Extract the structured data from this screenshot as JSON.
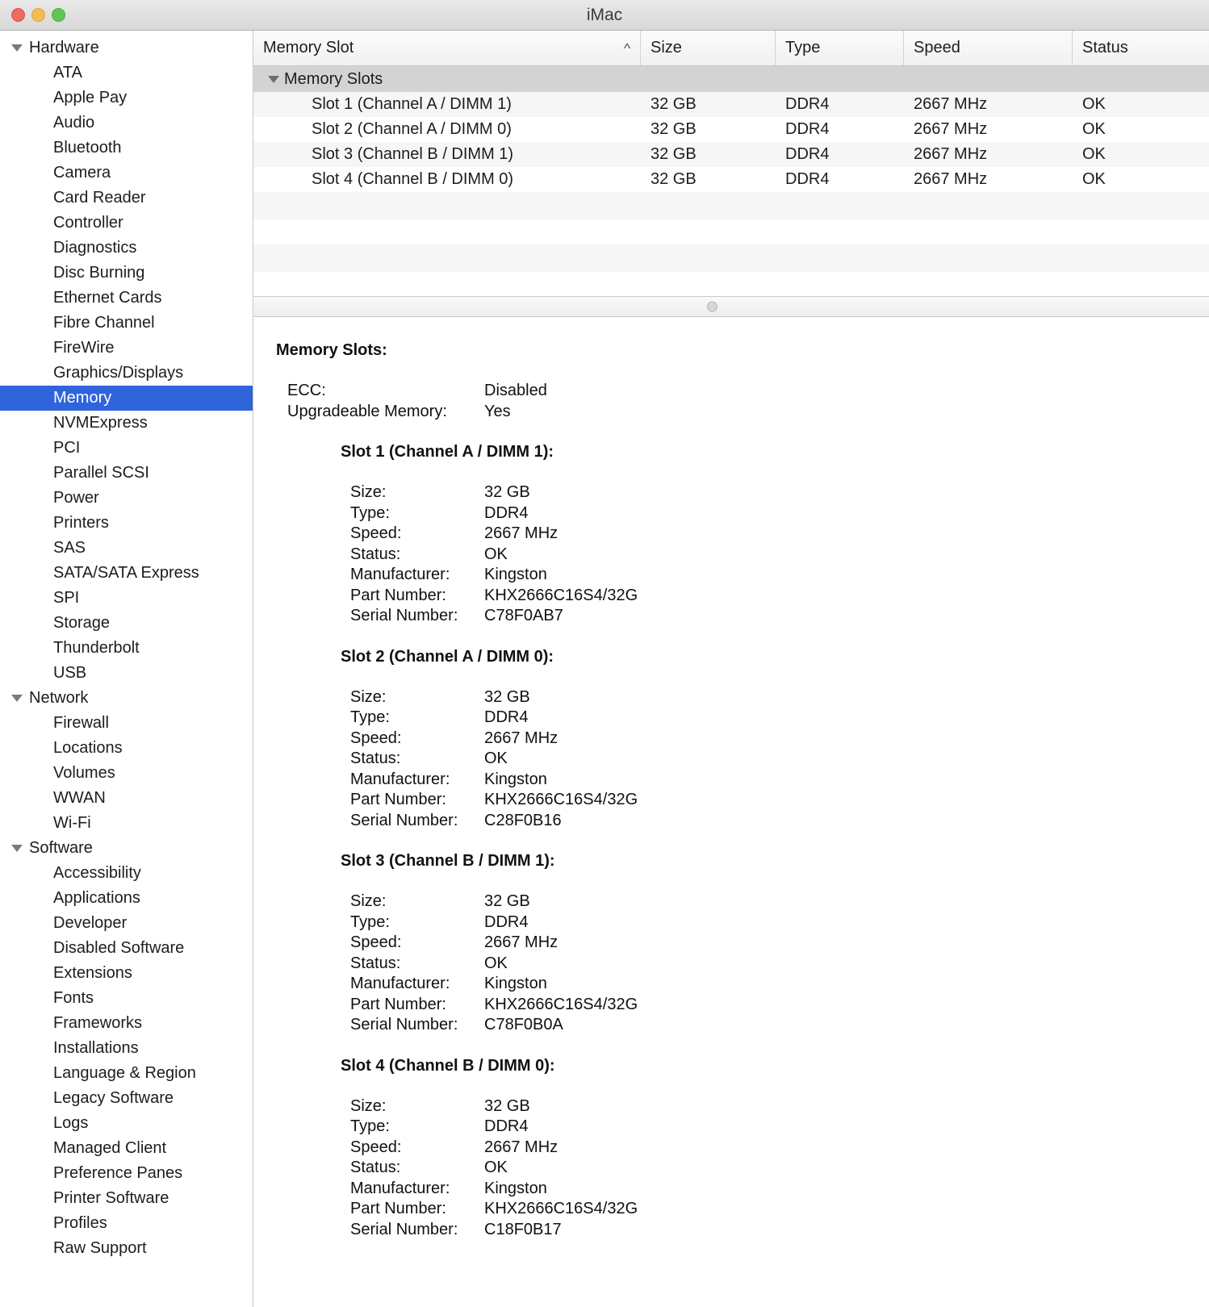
{
  "window": {
    "title": "iMac",
    "traffic_lights": [
      "close",
      "minimize",
      "maximize"
    ]
  },
  "sidebar": {
    "items": [
      {
        "label": "Hardware",
        "type": "group",
        "selected": false
      },
      {
        "label": "ATA",
        "type": "leaf",
        "selected": false
      },
      {
        "label": "Apple Pay",
        "type": "leaf",
        "selected": false
      },
      {
        "label": "Audio",
        "type": "leaf",
        "selected": false
      },
      {
        "label": "Bluetooth",
        "type": "leaf",
        "selected": false
      },
      {
        "label": "Camera",
        "type": "leaf",
        "selected": false
      },
      {
        "label": "Card Reader",
        "type": "leaf",
        "selected": false
      },
      {
        "label": "Controller",
        "type": "leaf",
        "selected": false
      },
      {
        "label": "Diagnostics",
        "type": "leaf",
        "selected": false
      },
      {
        "label": "Disc Burning",
        "type": "leaf",
        "selected": false
      },
      {
        "label": "Ethernet Cards",
        "type": "leaf",
        "selected": false
      },
      {
        "label": "Fibre Channel",
        "type": "leaf",
        "selected": false
      },
      {
        "label": "FireWire",
        "type": "leaf",
        "selected": false
      },
      {
        "label": "Graphics/Displays",
        "type": "leaf",
        "selected": false
      },
      {
        "label": "Memory",
        "type": "leaf",
        "selected": true
      },
      {
        "label": "NVMExpress",
        "type": "leaf",
        "selected": false
      },
      {
        "label": "PCI",
        "type": "leaf",
        "selected": false
      },
      {
        "label": "Parallel SCSI",
        "type": "leaf",
        "selected": false
      },
      {
        "label": "Power",
        "type": "leaf",
        "selected": false
      },
      {
        "label": "Printers",
        "type": "leaf",
        "selected": false
      },
      {
        "label": "SAS",
        "type": "leaf",
        "selected": false
      },
      {
        "label": "SATA/SATA Express",
        "type": "leaf",
        "selected": false
      },
      {
        "label": "SPI",
        "type": "leaf",
        "selected": false
      },
      {
        "label": "Storage",
        "type": "leaf",
        "selected": false
      },
      {
        "label": "Thunderbolt",
        "type": "leaf",
        "selected": false
      },
      {
        "label": "USB",
        "type": "leaf",
        "selected": false
      },
      {
        "label": "Network",
        "type": "group",
        "selected": false
      },
      {
        "label": "Firewall",
        "type": "leaf",
        "selected": false
      },
      {
        "label": "Locations",
        "type": "leaf",
        "selected": false
      },
      {
        "label": "Volumes",
        "type": "leaf",
        "selected": false
      },
      {
        "label": "WWAN",
        "type": "leaf",
        "selected": false
      },
      {
        "label": "Wi-Fi",
        "type": "leaf",
        "selected": false
      },
      {
        "label": "Software",
        "type": "group",
        "selected": false
      },
      {
        "label": "Accessibility",
        "type": "leaf",
        "selected": false
      },
      {
        "label": "Applications",
        "type": "leaf",
        "selected": false
      },
      {
        "label": "Developer",
        "type": "leaf",
        "selected": false
      },
      {
        "label": "Disabled Software",
        "type": "leaf",
        "selected": false
      },
      {
        "label": "Extensions",
        "type": "leaf",
        "selected": false
      },
      {
        "label": "Fonts",
        "type": "leaf",
        "selected": false
      },
      {
        "label": "Frameworks",
        "type": "leaf",
        "selected": false
      },
      {
        "label": "Installations",
        "type": "leaf",
        "selected": false
      },
      {
        "label": "Language & Region",
        "type": "leaf",
        "selected": false
      },
      {
        "label": "Legacy Software",
        "type": "leaf",
        "selected": false
      },
      {
        "label": "Logs",
        "type": "leaf",
        "selected": false
      },
      {
        "label": "Managed Client",
        "type": "leaf",
        "selected": false
      },
      {
        "label": "Preference Panes",
        "type": "leaf",
        "selected": false
      },
      {
        "label": "Printer Software",
        "type": "leaf",
        "selected": false
      },
      {
        "label": "Profiles",
        "type": "leaf",
        "selected": false
      },
      {
        "label": "Raw Support",
        "type": "leaf",
        "selected": false
      }
    ]
  },
  "table": {
    "columns": [
      "Memory Slot",
      "Size",
      "Type",
      "Speed",
      "Status"
    ],
    "sort_indicator": "^",
    "group_label": "Memory Slots",
    "rows": [
      {
        "slot": "Slot 1 (Channel A / DIMM 1)",
        "size": "32 GB",
        "type": "DDR4",
        "speed": "2667 MHz",
        "status": "OK"
      },
      {
        "slot": "Slot 2 (Channel A / DIMM 0)",
        "size": "32 GB",
        "type": "DDR4",
        "speed": "2667 MHz",
        "status": "OK"
      },
      {
        "slot": "Slot 3 (Channel B / DIMM 1)",
        "size": "32 GB",
        "type": "DDR4",
        "speed": "2667 MHz",
        "status": "OK"
      },
      {
        "slot": "Slot 4 (Channel B / DIMM 0)",
        "size": "32 GB",
        "type": "DDR4",
        "speed": "2667 MHz",
        "status": "OK"
      }
    ]
  },
  "detail": {
    "title": "Memory Slots:",
    "summary": [
      {
        "key": "ECC:",
        "value": "Disabled"
      },
      {
        "key": "Upgradeable Memory:",
        "value": "Yes"
      }
    ],
    "slots": [
      {
        "heading": "Slot 1 (Channel A / DIMM 1):",
        "fields": [
          {
            "key": "Size:",
            "value": "32 GB"
          },
          {
            "key": "Type:",
            "value": "DDR4"
          },
          {
            "key": "Speed:",
            "value": "2667 MHz"
          },
          {
            "key": "Status:",
            "value": "OK"
          },
          {
            "key": "Manufacturer:",
            "value": "Kingston"
          },
          {
            "key": "Part Number:",
            "value": "KHX2666C16S4/32G"
          },
          {
            "key": "Serial Number:",
            "value": "C78F0AB7"
          }
        ]
      },
      {
        "heading": "Slot 2 (Channel A / DIMM 0):",
        "fields": [
          {
            "key": "Size:",
            "value": "32 GB"
          },
          {
            "key": "Type:",
            "value": "DDR4"
          },
          {
            "key": "Speed:",
            "value": "2667 MHz"
          },
          {
            "key": "Status:",
            "value": "OK"
          },
          {
            "key": "Manufacturer:",
            "value": "Kingston"
          },
          {
            "key": "Part Number:",
            "value": "KHX2666C16S4/32G"
          },
          {
            "key": "Serial Number:",
            "value": "C28F0B16"
          }
        ]
      },
      {
        "heading": "Slot 3 (Channel B / DIMM 1):",
        "fields": [
          {
            "key": "Size:",
            "value": "32 GB"
          },
          {
            "key": "Type:",
            "value": "DDR4"
          },
          {
            "key": "Speed:",
            "value": "2667 MHz"
          },
          {
            "key": "Status:",
            "value": "OK"
          },
          {
            "key": "Manufacturer:",
            "value": "Kingston"
          },
          {
            "key": "Part Number:",
            "value": "KHX2666C16S4/32G"
          },
          {
            "key": "Serial Number:",
            "value": "C78F0B0A"
          }
        ]
      },
      {
        "heading": "Slot 4 (Channel B / DIMM 0):",
        "fields": [
          {
            "key": "Size:",
            "value": "32 GB"
          },
          {
            "key": "Type:",
            "value": "DDR4"
          },
          {
            "key": "Speed:",
            "value": "2667 MHz"
          },
          {
            "key": "Status:",
            "value": "OK"
          },
          {
            "key": "Manufacturer:",
            "value": "Kingston"
          },
          {
            "key": "Part Number:",
            "value": "KHX2666C16S4/32G"
          },
          {
            "key": "Serial Number:",
            "value": "C18F0B17"
          }
        ]
      }
    ]
  },
  "colors": {
    "selection_blue": "#2f64dd",
    "group_row_gray": "#d3d3d3",
    "stripe_gray": "#f6f6f6"
  }
}
